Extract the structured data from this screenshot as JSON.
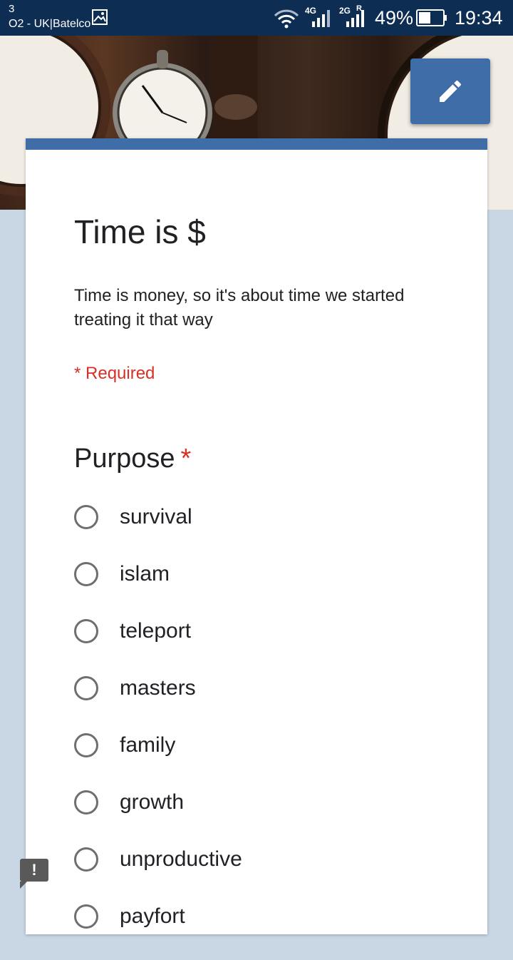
{
  "status_bar": {
    "notification_count": "3",
    "carrier": "O2 - UK|Batelco",
    "net1": "4G",
    "net2": "2G",
    "roaming": "R",
    "battery": "49%",
    "time": "19:34"
  },
  "colors": {
    "accent": "#3f6da7",
    "required": "#d93025",
    "status_bar": "#0e2d52",
    "page_bg": "#c9d6e3"
  },
  "form": {
    "title": "Time is $",
    "description": "Time is money, so it's about time we started treating it that way",
    "required_note": "* Required"
  },
  "question": {
    "title": "Purpose",
    "required_mark": "*",
    "options": [
      "survival",
      "islam",
      "teleport",
      "masters",
      "family",
      "growth",
      "unproductive",
      "payfort"
    ]
  },
  "feedback": {
    "icon": "!"
  }
}
